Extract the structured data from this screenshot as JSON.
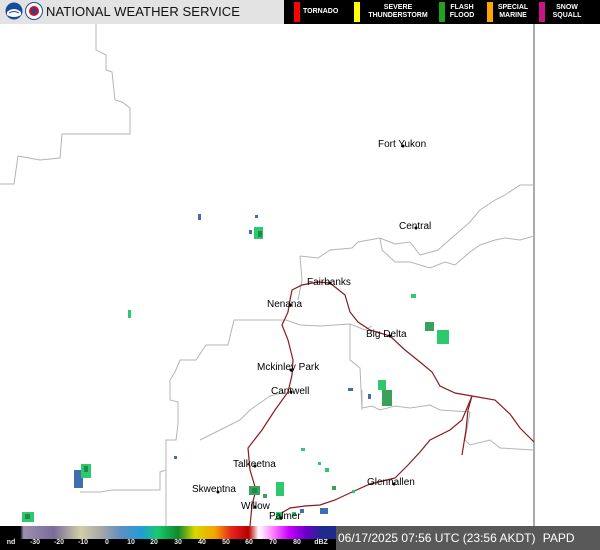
{
  "header": {
    "title": "NATIONAL WEATHER SERVICE",
    "logos": [
      "noaa-logo",
      "nws-logo"
    ]
  },
  "legend": {
    "items": [
      {
        "label": "TORNADO",
        "color": "#ff0000"
      },
      {
        "label": "SEVERE THUNDERSTORM",
        "color": "#ffff00"
      },
      {
        "label": "FLASH FLOOD",
        "color": "#22a022"
      },
      {
        "label": "SPECIAL MARINE",
        "color": "#ffa500"
      },
      {
        "label": "SNOW SQUALL",
        "color": "#c71585"
      }
    ]
  },
  "map": {
    "cities": [
      {
        "name": "Fort Yukon"
      },
      {
        "name": "Central"
      },
      {
        "name": "Fairbanks"
      },
      {
        "name": "Nenana"
      },
      {
        "name": "Big Delta"
      },
      {
        "name": "Mckinley Park"
      },
      {
        "name": "Cantwell"
      },
      {
        "name": "Talkeetna"
      },
      {
        "name": "Skwentna"
      },
      {
        "name": "Willow"
      },
      {
        "name": "Palmer"
      },
      {
        "name": "Glennallen"
      }
    ],
    "colors": {
      "border": "#b4b4b4",
      "road": "#8b1a1a",
      "echo_light": "#3aa05a",
      "echo_mid": "#2ec86e",
      "echo_blue": "#3f6fb0"
    }
  },
  "colorbar": {
    "labels": [
      "nd",
      "-30",
      "-20",
      "-10",
      "0",
      "10",
      "20",
      "30",
      "40",
      "50",
      "60",
      "70",
      "80",
      "dBZ"
    ]
  },
  "status": {
    "timestamp": "06/17/2025 07:56 UTC (23:56 AKDT)",
    "station": "PAPD"
  }
}
